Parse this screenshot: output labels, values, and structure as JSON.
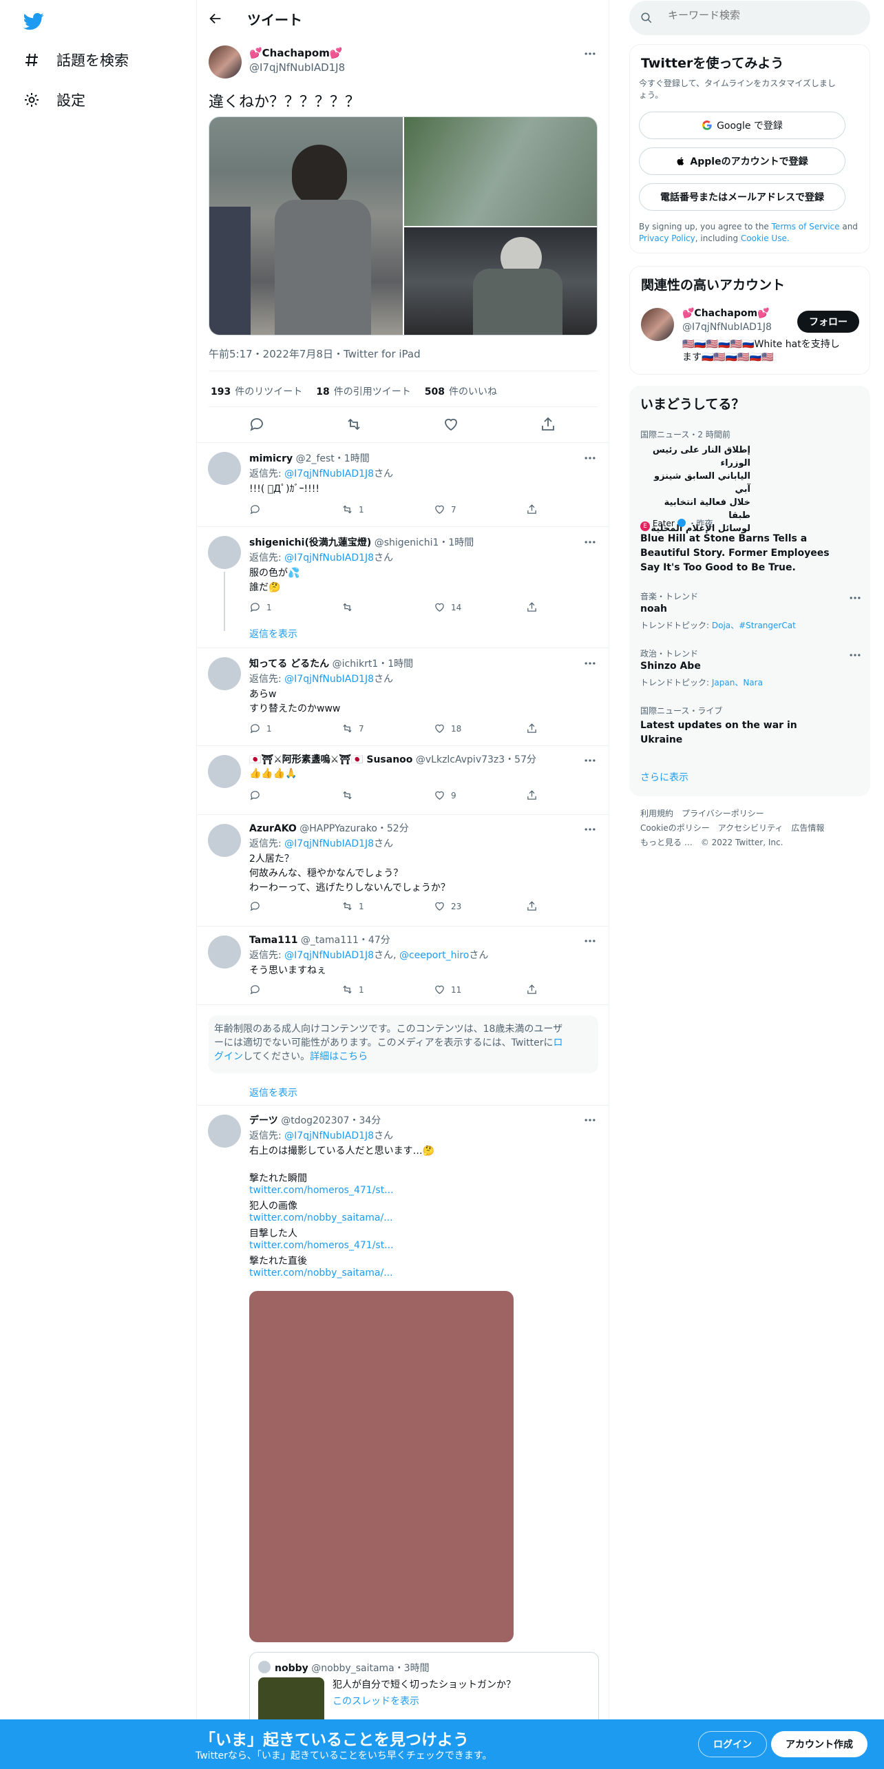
{
  "nav": {
    "explore": "話題を検索",
    "settings": "設定"
  },
  "header": {
    "title": "ツイート"
  },
  "tweet": {
    "name": "💕Chachapom💕",
    "handle": "@I7qjNfNubIAD1J8",
    "text": "違くねか？？？？？？",
    "time": "午前5:17・2022年7月8日・Twitter for iPad",
    "retweets": "193",
    "retweets_label": "件のリツイート",
    "quotes": "18",
    "quotes_label": "件の引用ツイート",
    "likes": "508",
    "likes_label": "件のいいね"
  },
  "replying_prefix": "返信先: ",
  "replying_suffix": "さん",
  "show_replies": "返信を表示",
  "replies": [
    {
      "name": "mimicry",
      "handle": "@2_fest",
      "time": "・1時間",
      "to": "@I7qjNfNubIAD1J8",
      "lines": [
        "!!!( ﾟДﾟ)ｶﾞｰ!!!!"
      ],
      "replies": "",
      "retweets": "1",
      "likes": "7"
    },
    {
      "name": "shigenichi(役満九蓮宝燈)",
      "handle": "@shigenichi1",
      "time": "・1時間",
      "to": "@I7qjNfNubIAD1J8",
      "lines": [
        "服の色が💦",
        "誰だ🤔"
      ],
      "replies": "1",
      "retweets": "",
      "likes": "14"
    },
    {
      "name": "知ってる どるたん",
      "handle": "@ichikrt1",
      "time": "・1時間",
      "to": "@I7qjNfNubIAD1J8",
      "lines": [
        "あらw",
        "すり替えたのかwww"
      ],
      "replies": "1",
      "retweets": "7",
      "likes": "18"
    },
    {
      "name": "🇯🇵⛩⚔阿形素盞嗚⚔⛩🇯🇵 Susanoo",
      "handle": "@vLkzlcAvpiv73z3",
      "time": "・57分",
      "lines": [
        "👍👍👍🙏"
      ],
      "replies": "",
      "retweets": "",
      "likes": "9"
    },
    {
      "name": "AzurAKO",
      "handle": "@HAPPYazurako",
      "time": "・52分",
      "to": "@I7qjNfNubIAD1J8",
      "lines": [
        "2人居た？",
        "何故みんな、穏やかなんでしょう？",
        "わーわーって、逃げたりしないんでしょうか？"
      ],
      "replies": "",
      "retweets": "1",
      "likes": "23"
    },
    {
      "name": "Tama111",
      "handle": "@_tama111",
      "time": "・47分",
      "to": "@I7qjNfNubIAD1J8",
      "to2": "@ceeport_hiro",
      "lines": [
        "そう思いますねぇ"
      ],
      "replies": "",
      "retweets": "1",
      "likes": "11"
    }
  ],
  "sensitive": {
    "text1": "年齢制限のある成人向けコンテンツです。このコンテンツは、18歳未満のユーザ",
    "text2": "ーには適切でない可能性があります。このメディアを表示するには、Twitterに",
    "login": "ロ",
    "text3_link": "グイン",
    "text3": "してください。",
    "details": "詳細はこちら"
  },
  "long_reply": {
    "name": "デーツ",
    "handle": "@tdog202307",
    "time": "・34分",
    "to": "@I7qjNfNubIAD1J8",
    "text": "右上のは撮影している人だと思います…🤔",
    "items": [
      {
        "label": "撃たれた瞬間",
        "link": "twitter.com/homeros_471/st..."
      },
      {
        "label": "犯人の画像",
        "link": "twitter.com/nobby_saitama/..."
      },
      {
        "label": "目撃した人",
        "link": "twitter.com/homeros_471/st..."
      },
      {
        "label": "撃たれた直後",
        "link": "twitter.com/nobby_saitama/..."
      }
    ],
    "media_color": "#9e6464",
    "quote": {
      "name": "nobby",
      "handle": "@nobby_saitama",
      "time": "・3時間",
      "text": "犯人が自分で短く切ったショットガンか？",
      "thread_link": "このスレッドを表示"
    }
  },
  "right": {
    "search_placeholder": "キーワード検索",
    "signup_card": {
      "title": "Twitterを使ってみよう",
      "sub1": "今すぐ登録して、タイムラインをカスタマイズしまし",
      "sub2": "ょう。",
      "google": "Google で登録",
      "apple": "Appleのアカウントで登録",
      "phone": "電話番号またはメールアドレスで登録",
      "terms_prefix": "By signing up, you agree to the ",
      "terms": "Terms of Service",
      "and": " and",
      "privacy": "Privacy Policy",
      "including": ", including ",
      "cookie": "Cookie Use."
    },
    "related": {
      "title": "関連性の高いアカウント",
      "name": "💕Chachapom💕",
      "handle": "@I7qjNfNubIAD1J8",
      "follow": "フォロー",
      "bio1": "🇺🇸🇷🇺🇺🇸🇷🇺🇺🇸🇷🇺White hatを支持し",
      "bio2": "ます🇷🇺🇺🇸🇷🇺🇺🇸🇷🇺🇺🇸"
    },
    "trends": {
      "title": "いまどうしてる？",
      "items": [
        {
          "meta": "国際ニュース・2 時間前",
          "lines": [
            "إطلاق النار على رئيس الوزراء",
            "الياباني السابق شينزو آبي",
            "خلال فعالية انتخابية طبقا",
            "لوسائل الإعلام المحلية"
          ]
        },
        {
          "meta_source": "Eater",
          "meta_time": "・昨夜",
          "lines": [
            "Blue Hill at Stone Barns Tells a",
            "Beautiful Story. Former Employees",
            "Say It's Too Good to Be True."
          ]
        },
        {
          "meta": "音楽・トレンド",
          "name": "noah",
          "topics_label": "トレンドトピック: ",
          "topics": "Doja、#StrangerCat"
        },
        {
          "meta": "政治・トレンド",
          "name": "Shinzo Abe",
          "topics_label": "トレンドトピック: ",
          "topics": "Japan、Nara"
        },
        {
          "meta": "国際ニュース・ライブ",
          "lines": [
            "Latest updates on the war in",
            "Ukraine"
          ]
        }
      ],
      "show_more": "さらに表示"
    },
    "footer": {
      "line1": "利用規約　プライバシーポリシー",
      "line2": "Cookieのポリシー　アクセシビリティ　広告情報",
      "line3": "もっと見る …　© 2022 Twitter, Inc."
    }
  },
  "bottom": {
    "title": "「いま」起きていることを見つけよう",
    "sub": "Twitterなら、「いま」起きていることをいち早くチェックできます。",
    "login": "ログイン",
    "signup": "アカウント作成"
  }
}
